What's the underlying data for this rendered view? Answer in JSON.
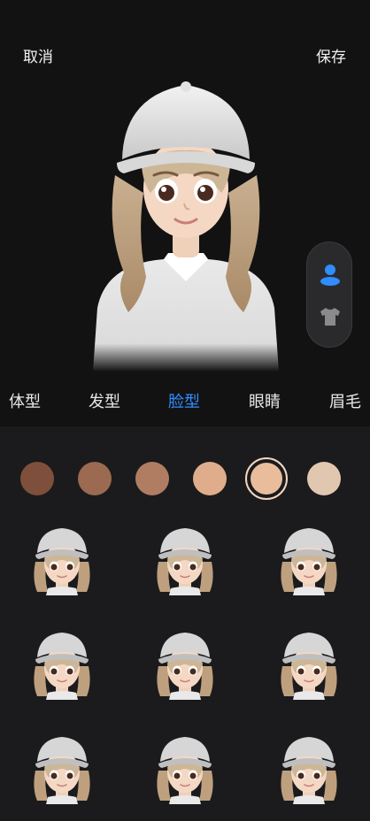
{
  "header": {
    "cancel_label": "取消",
    "save_label": "保存"
  },
  "side_toggle": {
    "active": "face-icon",
    "icons": [
      "person-icon",
      "shirt-icon"
    ]
  },
  "tabs": [
    {
      "label": "体型",
      "active": false
    },
    {
      "label": "发型",
      "active": false
    },
    {
      "label": "脸型",
      "active": true
    },
    {
      "label": "眼睛",
      "active": false
    },
    {
      "label": "眉毛",
      "active": false
    }
  ],
  "skin_tones": [
    {
      "color": "#7e503b",
      "selected": false
    },
    {
      "color": "#9b6a51",
      "selected": false
    },
    {
      "color": "#b07d63",
      "selected": false
    },
    {
      "color": "#e0ad8c",
      "selected": false
    },
    {
      "color": "#e9bd9c",
      "selected": true
    },
    {
      "color": "#e2c7b0",
      "selected": false
    }
  ],
  "colors": {
    "accent": "#2f8dff",
    "background": "#121213",
    "panel": "#1b1b1d"
  }
}
